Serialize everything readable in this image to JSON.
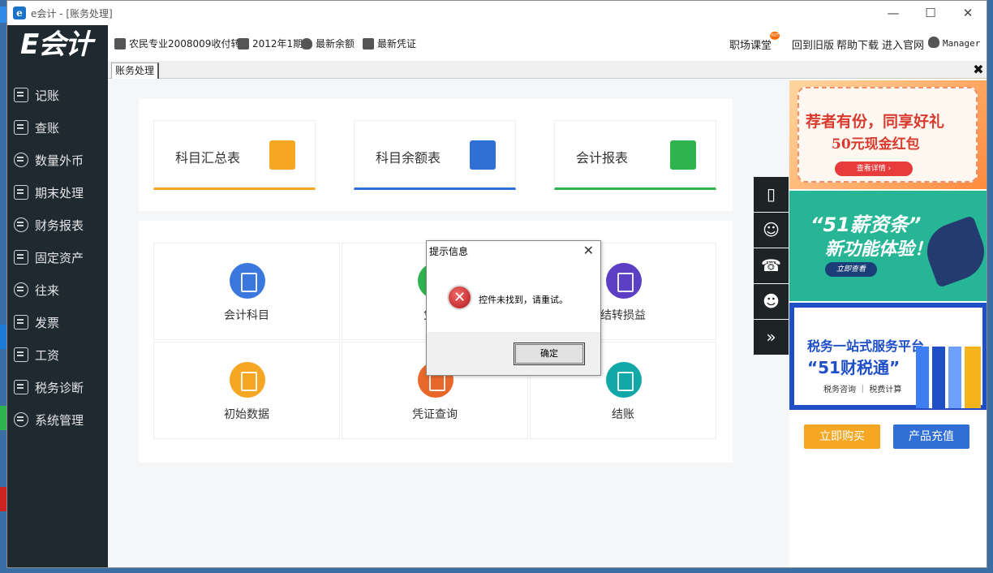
{
  "window": {
    "title": "e会计 - [账务处理]",
    "app_icon": "e"
  },
  "sidebar": {
    "logo": "E会计",
    "items": [
      {
        "label": "记账",
        "icon": "edit-icon"
      },
      {
        "label": "查账",
        "icon": "search-doc-icon"
      },
      {
        "label": "数量外币",
        "icon": "currency-icon"
      },
      {
        "label": "期末处理",
        "icon": "calendar-icon"
      },
      {
        "label": "财务报表",
        "icon": "report-icon"
      },
      {
        "label": "固定资产",
        "icon": "asset-icon"
      },
      {
        "label": "往来",
        "icon": "exchange-icon"
      },
      {
        "label": "发票",
        "icon": "invoice-icon"
      },
      {
        "label": "工资",
        "icon": "wallet-icon"
      },
      {
        "label": "税务诊断",
        "icon": "diagnosis-icon"
      },
      {
        "label": "系统管理",
        "icon": "settings-icon"
      }
    ]
  },
  "header": {
    "company": "农民专业2008009收付转",
    "period": "2012年1期",
    "balance": "最新余额",
    "voucher": "最新凭证",
    "course": "职场课堂",
    "hot_badge": "HOT",
    "old_version": "回到旧版",
    "help": "帮助下载",
    "website": "进入官网",
    "user": "Manager"
  },
  "tabs": [
    {
      "label": "账务处理"
    }
  ],
  "top_cards": [
    {
      "label": "科目汇总表",
      "color": "#f5a623"
    },
    {
      "label": "科目余额表",
      "color": "#2f6fd6"
    },
    {
      "label": "会计报表",
      "color": "#2fb34f"
    }
  ],
  "grid": [
    {
      "label": "会计科目",
      "color": "#3a78e0"
    },
    {
      "label": "凭证",
      "color": "#2fb34f"
    },
    {
      "label": "结转损益",
      "color": "#5b3fc4"
    },
    {
      "label": "初始数据",
      "color": "#f5a623"
    },
    {
      "label": "凭证查询",
      "color": "#e8682a"
    },
    {
      "label": "结账",
      "color": "#13a8a8"
    }
  ],
  "ads": {
    "ad1": {
      "line1": "荐者有份，同享好礼",
      "line2": "50元现金红包",
      "button": "查看详情 ›"
    },
    "ad2": {
      "line1": "“51薪资条”",
      "line2": "新功能体验！",
      "button": "立即查看"
    },
    "ad3": {
      "line1": "税务一站式服务平台",
      "line2": "“51财税通”",
      "line3": "税务咨询 ｜ 税费计算"
    }
  },
  "buttons": {
    "buy": "立即购买",
    "recharge": "产品充值"
  },
  "dialog": {
    "title": "提示信息",
    "message": "控件未找到，请重试。",
    "ok": "确定"
  },
  "colors": {
    "sidebar": "#1e2a30",
    "buy": "#f5a623",
    "recharge": "#2f6fd6"
  }
}
